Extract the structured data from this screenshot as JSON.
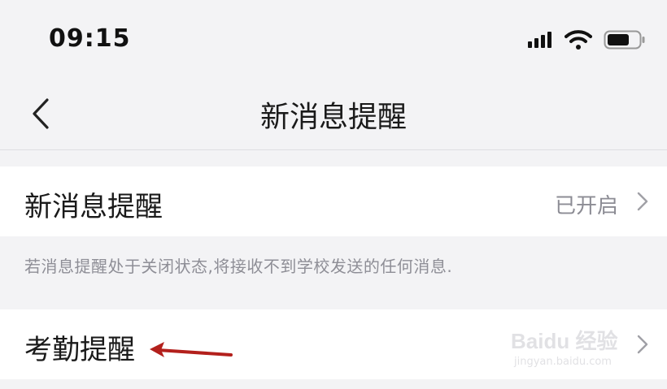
{
  "status_bar": {
    "time": "09:15",
    "icons": [
      "cellular-signal-icon",
      "wifi-icon",
      "battery-icon"
    ]
  },
  "nav": {
    "back_icon": "chevron-left-icon",
    "title": "新消息提醒"
  },
  "settings": {
    "new_message_label": "新消息提醒",
    "new_message_value": "已开启",
    "hint": "若消息提醒处于关闭状态,将接收不到学校发送的任何消息.",
    "attendance_label": "考勤提醒"
  },
  "watermark": {
    "brand": "Baidu 经验",
    "url": "jingyan.baidu.com"
  },
  "colors": {
    "background": "#f3f3f5",
    "row": "#ffffff",
    "secondary_text": "#8c8c94",
    "annotation_arrow": "#b3201c"
  }
}
